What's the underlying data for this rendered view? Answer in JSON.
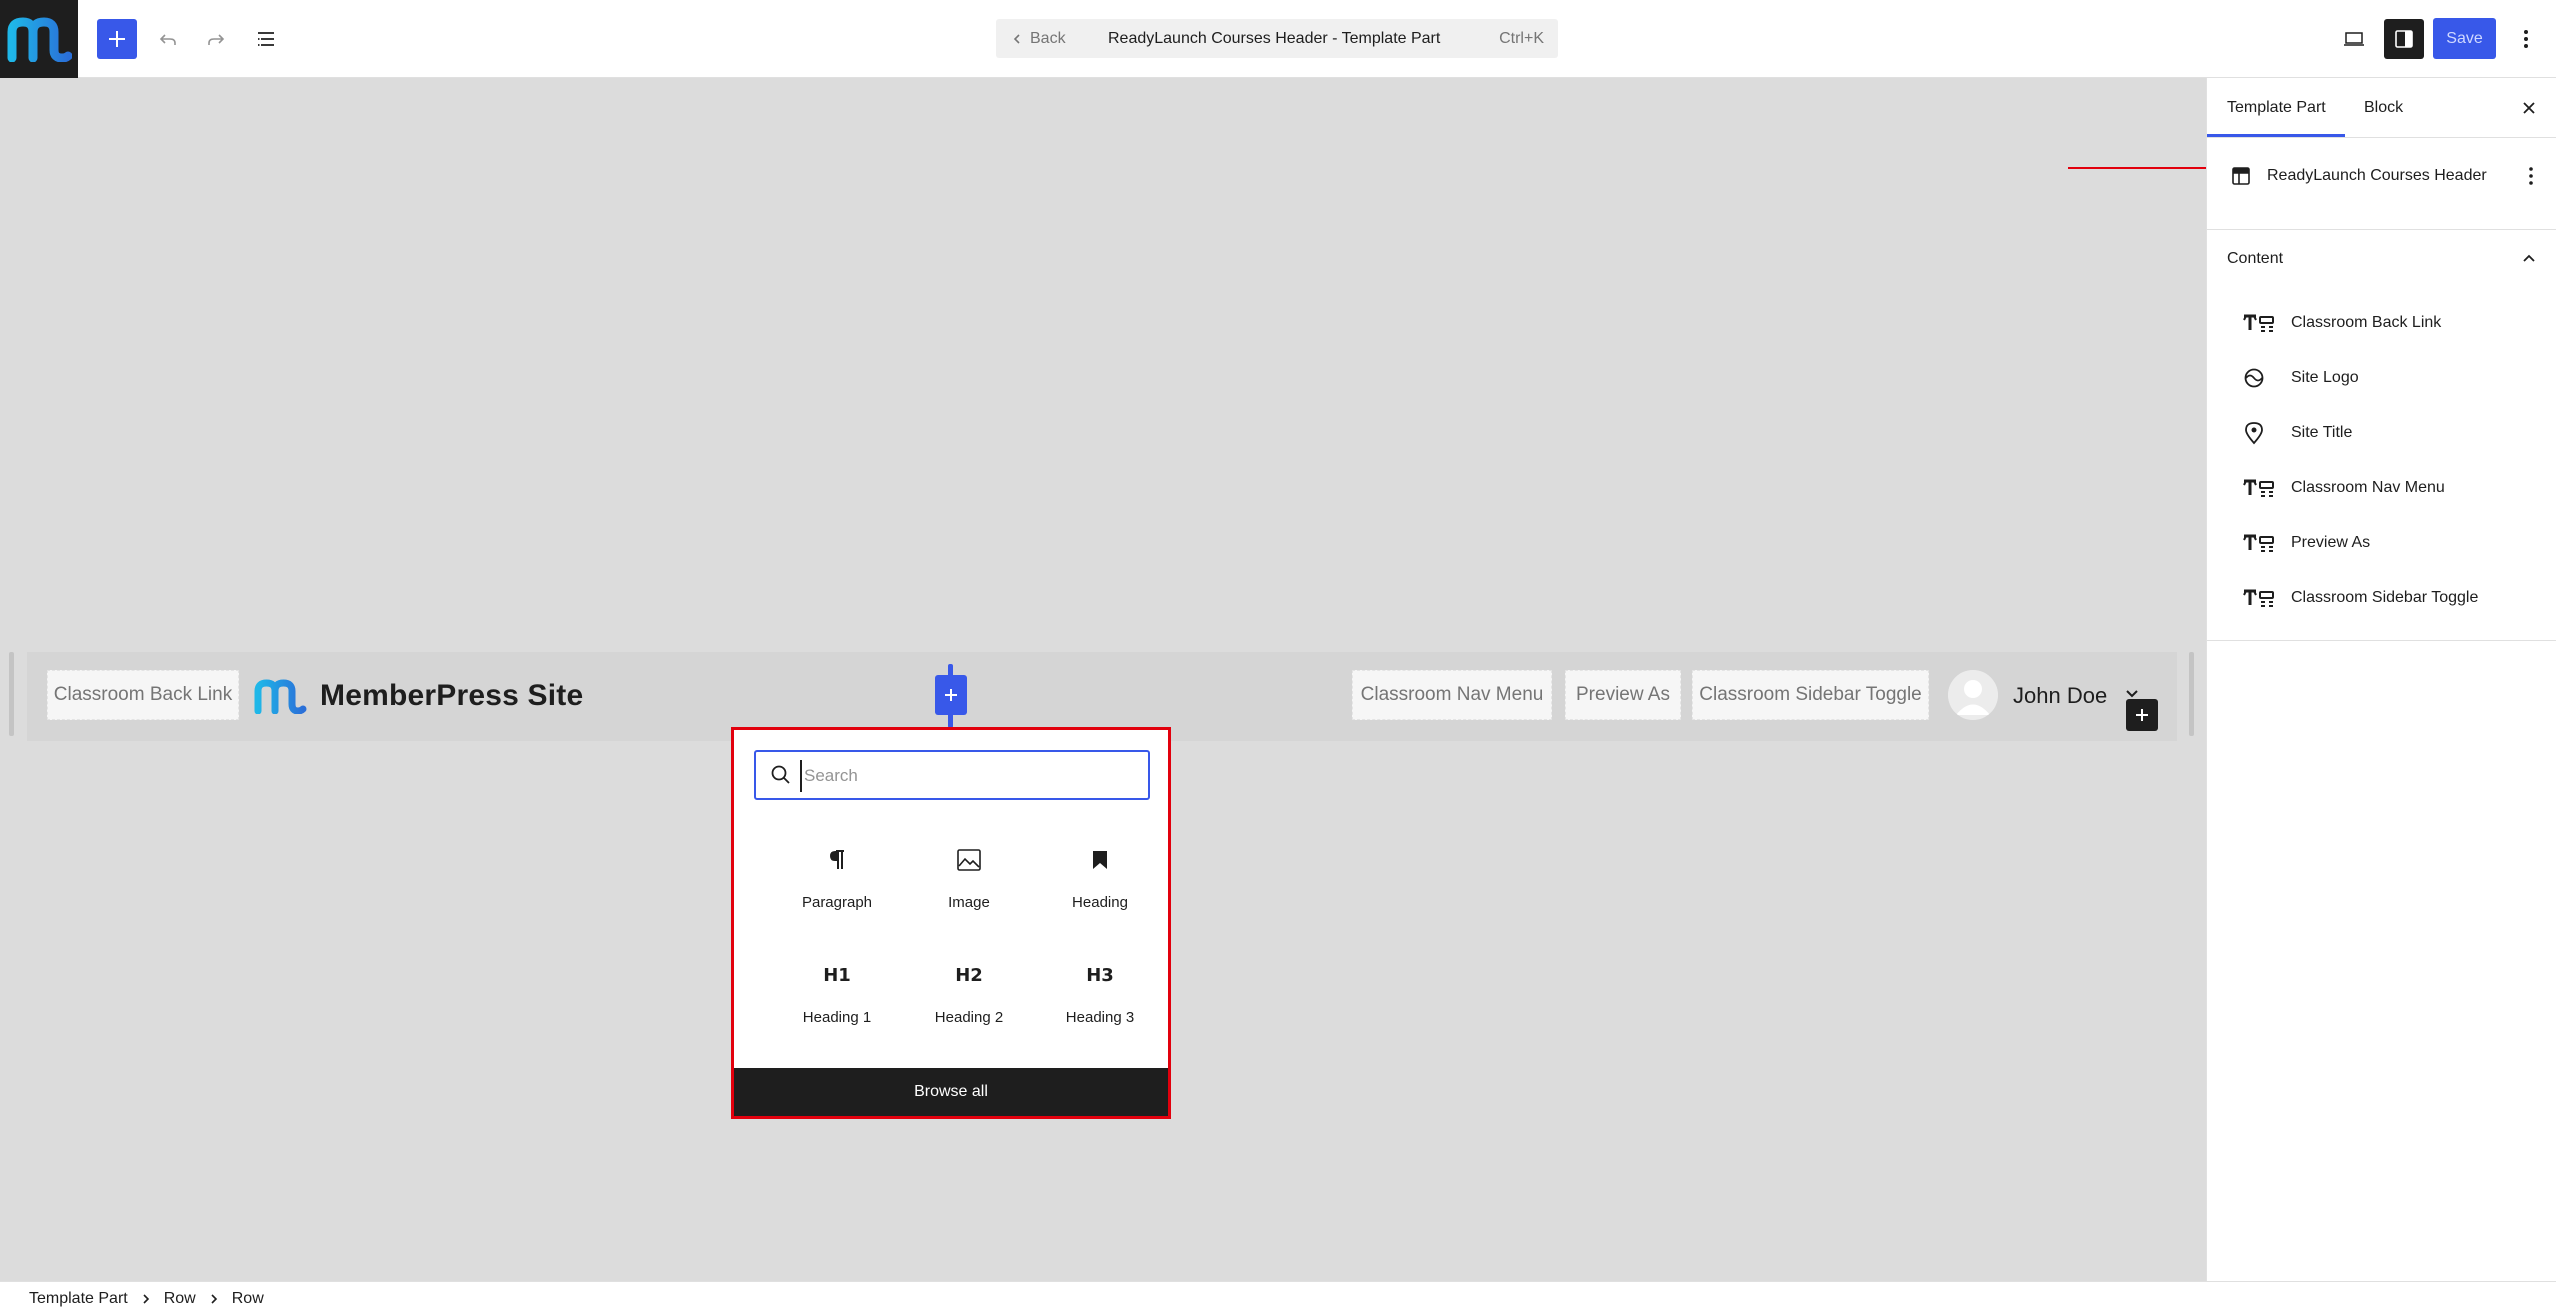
{
  "header": {
    "doc_back_label": "Back",
    "doc_title": "ReadyLaunch Courses Header - Template Part",
    "doc_shortcut": "Ctrl+K",
    "save_label": "Save"
  },
  "canvas": {
    "back_link_label": "Classroom Back Link",
    "site_title": "MemberPress Site",
    "nav_menu_label": "Classroom Nav Menu",
    "preview_as_label": "Preview As",
    "sidebar_toggle_label": "Classroom Sidebar Toggle",
    "user_name": "John Doe"
  },
  "inserter": {
    "search_placeholder": "Search",
    "blocks": [
      {
        "label": "Paragraph",
        "icon": "paragraph-icon"
      },
      {
        "label": "Image",
        "icon": "image-icon"
      },
      {
        "label": "Heading",
        "icon": "bookmark-icon"
      },
      {
        "label": "Heading 1",
        "glyph": "H1"
      },
      {
        "label": "Heading 2",
        "glyph": "H2"
      },
      {
        "label": "Heading 3",
        "glyph": "H3"
      }
    ],
    "browse_all_label": "Browse all"
  },
  "sidebar": {
    "tabs": [
      {
        "label": "Template Part",
        "active": true
      },
      {
        "label": "Block",
        "active": false
      }
    ],
    "template_part_name": "ReadyLaunch Courses Header",
    "content_title": "Content",
    "content_items": [
      {
        "label": "Classroom Back Link",
        "icon": "shortcode-icon"
      },
      {
        "label": "Site Logo",
        "icon": "site-logo-icon"
      },
      {
        "label": "Site Title",
        "icon": "map-marker-icon"
      },
      {
        "label": "Classroom Nav Menu",
        "icon": "shortcode-icon"
      },
      {
        "label": "Preview As",
        "icon": "shortcode-icon"
      },
      {
        "label": "Classroom Sidebar Toggle",
        "icon": "shortcode-icon"
      }
    ]
  },
  "footer": {
    "breadcrumbs": [
      "Template Part",
      "Row",
      "Row"
    ]
  },
  "colors": {
    "accent": "#3858e9",
    "dark": "#1e1e1e",
    "highlight": "#e2000d"
  }
}
